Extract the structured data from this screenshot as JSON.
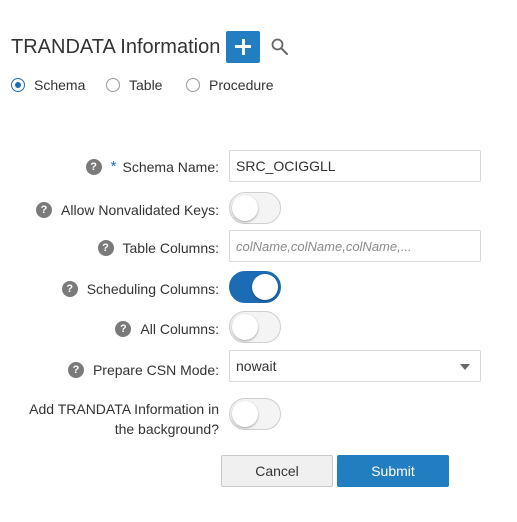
{
  "header": {
    "title": "TRANDATA Information",
    "add_icon": "plus-icon",
    "search_icon": "search-icon"
  },
  "scope": {
    "options": [
      {
        "label": "Schema",
        "checked": true
      },
      {
        "label": "Table",
        "checked": false
      },
      {
        "label": "Procedure",
        "checked": false
      }
    ]
  },
  "form": {
    "schema_name": {
      "label": "Schema Name:",
      "required": true,
      "value": "SRC_OCIGGLL"
    },
    "allow_nonvalidated_keys": {
      "label": "Allow Nonvalidated Keys:",
      "on": false
    },
    "table_columns": {
      "label": "Table Columns:",
      "placeholder": "colName,colName,colName,..."
    },
    "scheduling_columns": {
      "label": "Scheduling Columns:",
      "on": true
    },
    "all_columns": {
      "label": "All Columns:",
      "on": false
    },
    "prepare_csn_mode": {
      "label": "Prepare CSN Mode:",
      "value": "nowait"
    },
    "background": {
      "label_line1": "Add TRANDATA Information in",
      "label_line2": "the background?",
      "on": false
    }
  },
  "buttons": {
    "cancel": "Cancel",
    "submit": "Submit"
  },
  "colors": {
    "accent": "#227dc1",
    "toggle_on": "#1c6bb5",
    "help_icon": "#7a7a7a"
  }
}
